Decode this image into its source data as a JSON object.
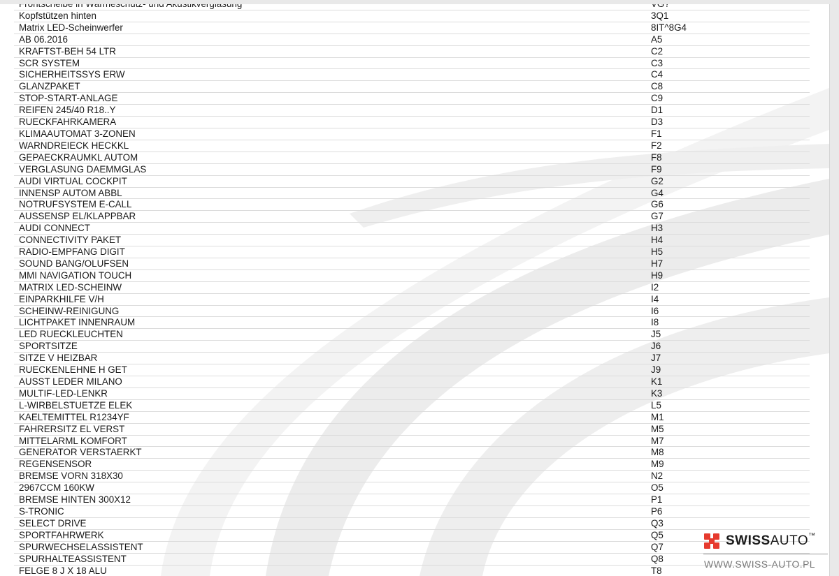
{
  "equipment": [
    {
      "name": "Frontscheibe in Wärmeschutz- und Akustikverglasung",
      "code": "VG?"
    },
    {
      "name": "Kopfstützen hinten",
      "code": "3Q1"
    },
    {
      "name": "Matrix LED-Scheinwerfer",
      "code": "8IT^8G4"
    },
    {
      "name": "AB 06.2016",
      "code": "A5"
    },
    {
      "name": "KRAFTST-BEH 54 LTR",
      "code": "C2"
    },
    {
      "name": "SCR SYSTEM",
      "code": "C3"
    },
    {
      "name": "SICHERHEITSSYS ERW",
      "code": "C4"
    },
    {
      "name": "GLANZPAKET",
      "code": "C8"
    },
    {
      "name": "STOP-START-ANLAGE",
      "code": "C9"
    },
    {
      "name": "REIFEN 245/40 R18..Y",
      "code": "D1"
    },
    {
      "name": "RUECKFAHRKAMERA",
      "code": "D3"
    },
    {
      "name": "KLIMAAUTOMAT 3-ZONEN",
      "code": "F1"
    },
    {
      "name": "WARNDREIECK HECKKL",
      "code": "F2"
    },
    {
      "name": "GEPAECKRAUMKL AUTOM",
      "code": "F8"
    },
    {
      "name": "VERGLASUNG DAEMMGLAS",
      "code": "F9"
    },
    {
      "name": "AUDI VIRTUAL COCKPIT",
      "code": "G2"
    },
    {
      "name": "INNENSP AUTOM ABBL",
      "code": "G4"
    },
    {
      "name": "NOTRUFSYSTEM E-CALL",
      "code": "G6"
    },
    {
      "name": "AUSSENSP EL/KLAPPBAR",
      "code": "G7"
    },
    {
      "name": "AUDI CONNECT",
      "code": "H3"
    },
    {
      "name": "CONNECTIVITY PAKET",
      "code": "H4"
    },
    {
      "name": "RADIO-EMPFANG DIGIT",
      "code": "H5"
    },
    {
      "name": "SOUND BANG/OLUFSEN",
      "code": "H7"
    },
    {
      "name": "MMI NAVIGATION TOUCH",
      "code": "H9"
    },
    {
      "name": "MATRIX LED-SCHEINW",
      "code": "I2"
    },
    {
      "name": "EINPARKHILFE V/H",
      "code": "I4"
    },
    {
      "name": "SCHEINW-REINIGUNG",
      "code": "I6"
    },
    {
      "name": "LICHTPAKET INNENRAUM",
      "code": "I8"
    },
    {
      "name": "LED RUECKLEUCHTEN",
      "code": "J5"
    },
    {
      "name": "SPORTSITZE",
      "code": "J6"
    },
    {
      "name": "SITZE V HEIZBAR",
      "code": "J7"
    },
    {
      "name": "RUECKENLEHNE H GET",
      "code": "J9"
    },
    {
      "name": "AUSST LEDER MILANO",
      "code": "K1"
    },
    {
      "name": "MULTIF-LED-LENKR",
      "code": "K3"
    },
    {
      "name": "L-WIRBELSTUETZE ELEK",
      "code": "L5"
    },
    {
      "name": "KAELTEMITTEL R1234YF",
      "code": "M1"
    },
    {
      "name": "FAHRERSITZ EL VERST",
      "code": "M5"
    },
    {
      "name": "MITTELARML KOMFORT",
      "code": "M7"
    },
    {
      "name": "GENERATOR VERSTAERKT",
      "code": "M8"
    },
    {
      "name": "REGENSENSOR",
      "code": "M9"
    },
    {
      "name": "BREMSE VORN 318X30",
      "code": "N2"
    },
    {
      "name": "2967CCM 160KW",
      "code": "O5"
    },
    {
      "name": "BREMSE HINTEN 300X12",
      "code": "P1"
    },
    {
      "name": "S-TRONIC",
      "code": "P6"
    },
    {
      "name": "SELECT DRIVE",
      "code": "Q3"
    },
    {
      "name": "SPORTFAHRWERK",
      "code": "Q5"
    },
    {
      "name": "SPURWECHSELASSISTENT",
      "code": "Q7"
    },
    {
      "name": "SPURHALTEASSISTENT",
      "code": "Q8"
    },
    {
      "name": "FELGE 8 J X 18 ALU",
      "code": "T8"
    }
  ],
  "logo": {
    "brand_bold": "SWISS",
    "brand_thin": "AUTO",
    "trademark": "™",
    "url": "WWW.SWISS-AUTO.PL",
    "mark_color": "#e63a2e"
  }
}
